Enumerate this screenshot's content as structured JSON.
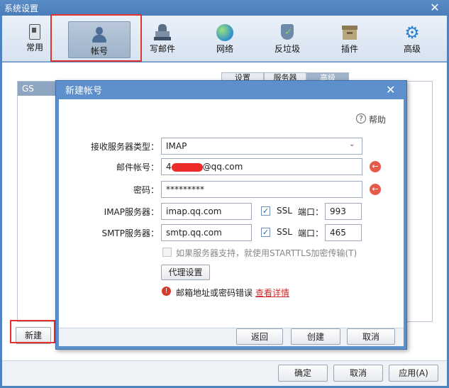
{
  "outer_window": {
    "title": "系统设置"
  },
  "toolbar": {
    "items": [
      {
        "label": "常用",
        "icon": "phone-icon"
      },
      {
        "label": "帐号",
        "icon": "user-icon"
      },
      {
        "label": "写邮件",
        "icon": "stamp-icon"
      },
      {
        "label": "网络",
        "icon": "globe-icon"
      },
      {
        "label": "反垃圾",
        "icon": "shield-icon"
      },
      {
        "label": "插件",
        "icon": "box-icon"
      },
      {
        "label": "高级",
        "icon": "gear-icon"
      }
    ],
    "active_index": 1
  },
  "account_list": {
    "items": [
      "GS"
    ]
  },
  "tabs": [
    "设置",
    "服务器",
    "高级"
  ],
  "new_button": {
    "label": "新建"
  },
  "bottom_buttons": {
    "ok": "确定",
    "cancel": "取消",
    "apply": "应用(A)"
  },
  "dialog": {
    "title": "新建帐号",
    "help": "帮助",
    "server_type": {
      "label": "接收服务器类型：",
      "value": "IMAP"
    },
    "email": {
      "label": "邮件帐号：",
      "prefix": "4",
      "suffix": "@qq.com"
    },
    "password": {
      "label": "密码：",
      "value": "*********"
    },
    "imap": {
      "label": "IMAP服务器：",
      "value": "imap.qq.com",
      "ssl_label": "SSL",
      "ssl_checked": true,
      "port_label": "端口：",
      "port": "993"
    },
    "smtp": {
      "label": "SMTP服务器：",
      "value": "smtp.qq.com",
      "ssl_label": "SSL",
      "ssl_checked": true,
      "port_label": "端口：",
      "port": "465"
    },
    "starttls_label": "如果服务器支持，就使用STARTTLS加密传输(T)",
    "proxy_button": "代理设置",
    "error_text": "邮箱地址或密码错误",
    "error_link": "查看详情",
    "buttons": {
      "back": "返回",
      "create": "创建",
      "cancel": "取消"
    }
  },
  "colors": {
    "title_bar": "#4a7db9",
    "error": "#e65a4a",
    "highlight_box": "#e53030"
  }
}
